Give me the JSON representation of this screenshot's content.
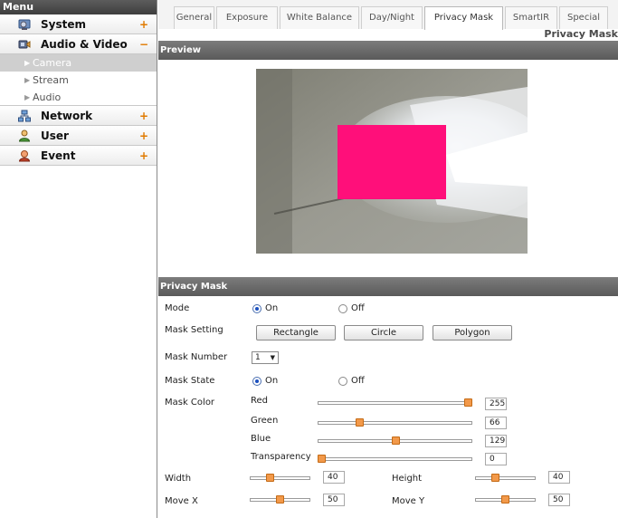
{
  "sidebar": {
    "title": "Menu",
    "sections": [
      {
        "label": "System",
        "sign": "+"
      },
      {
        "label": "Audio & Video",
        "sign": "−"
      },
      {
        "label": "Network",
        "sign": "+"
      },
      {
        "label": "User",
        "sign": "+"
      },
      {
        "label": "Event",
        "sign": "+"
      }
    ],
    "subitems": [
      {
        "label": "Camera",
        "active": true
      },
      {
        "label": "Stream",
        "active": false
      },
      {
        "label": "Audio",
        "active": false
      }
    ]
  },
  "tabs": [
    "General",
    "Exposure",
    "White Balance",
    "Day/Night",
    "Privacy Mask",
    "SmartIR",
    "Special"
  ],
  "active_tab": "Privacy Mask",
  "page_title": "Privacy Mask",
  "preview": {
    "header": "Preview",
    "mask_color": "#ff0f7a"
  },
  "privacy_mask": {
    "header": "Privacy Mask",
    "mode": {
      "label": "Mode",
      "on": "On",
      "off": "Off",
      "value": "On"
    },
    "mask_setting": {
      "label": "Mask Setting",
      "buttons": [
        "Rectangle",
        "Circle",
        "Polygon"
      ]
    },
    "mask_number": {
      "label": "Mask Number",
      "value": "1"
    },
    "mask_state": {
      "label": "Mask State",
      "on": "On",
      "off": "Off",
      "value": "On"
    },
    "mask_color": {
      "label": "Mask Color",
      "channels": [
        {
          "name": "Red",
          "value": "255",
          "fraction": 1.0
        },
        {
          "name": "Green",
          "value": "66",
          "fraction": 0.259
        },
        {
          "name": "Blue",
          "value": "129",
          "fraction": 0.506
        },
        {
          "name": "Transparency",
          "value": "0",
          "fraction": 0.0
        }
      ]
    },
    "width": {
      "label": "Width",
      "value": "40",
      "fraction": 0.31
    },
    "height": {
      "label": "Height",
      "value": "40",
      "fraction": 0.31
    },
    "move_x": {
      "label": "Move X",
      "value": "50",
      "fraction": 0.5
    },
    "move_y": {
      "label": "Move Y",
      "value": "50",
      "fraction": 0.5
    }
  },
  "colors": {
    "accent_orange": "#f2994a",
    "header_bar": "#6b6b6b",
    "radio_selected": "#1a4fbf"
  }
}
